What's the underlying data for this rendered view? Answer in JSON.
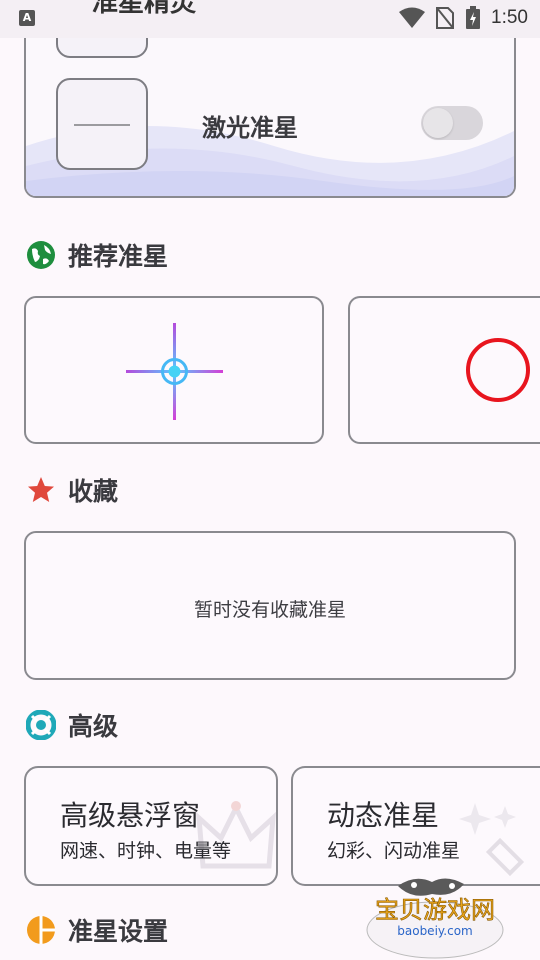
{
  "status_bar": {
    "app_badge": "A",
    "title_peek": "准星精灵",
    "time": "1:50",
    "icons": [
      "wifi-icon",
      "no-sim-icon",
      "battery-charging-icon"
    ]
  },
  "laser_item": {
    "label": "激光准星",
    "toggle_on": false
  },
  "sections": {
    "recommended": {
      "title": "推荐准星",
      "icon": "globe-icon",
      "color": "#1e8e3e"
    },
    "favorites": {
      "title": "收藏",
      "icon": "star-icon",
      "color": "#e0483c",
      "empty_text": "暂时没有收藏准星"
    },
    "advanced": {
      "title": "高级",
      "icon": "lifebuoy-icon",
      "color": "#1fa8b8"
    },
    "settings": {
      "title": "准星设置",
      "icon": "pie-icon",
      "color": "#f29b1d"
    }
  },
  "advanced_cards": [
    {
      "title": "高级悬浮窗",
      "subtitle": "网速、时钟、电量等",
      "icon": "crown-icon"
    },
    {
      "title": "动态准星",
      "subtitle": "幻彩、闪动准星",
      "icon": "sparkle-wand-icon"
    }
  ],
  "watermark": {
    "brand": "宝贝游戏网",
    "domain": "baobeiy.com"
  }
}
